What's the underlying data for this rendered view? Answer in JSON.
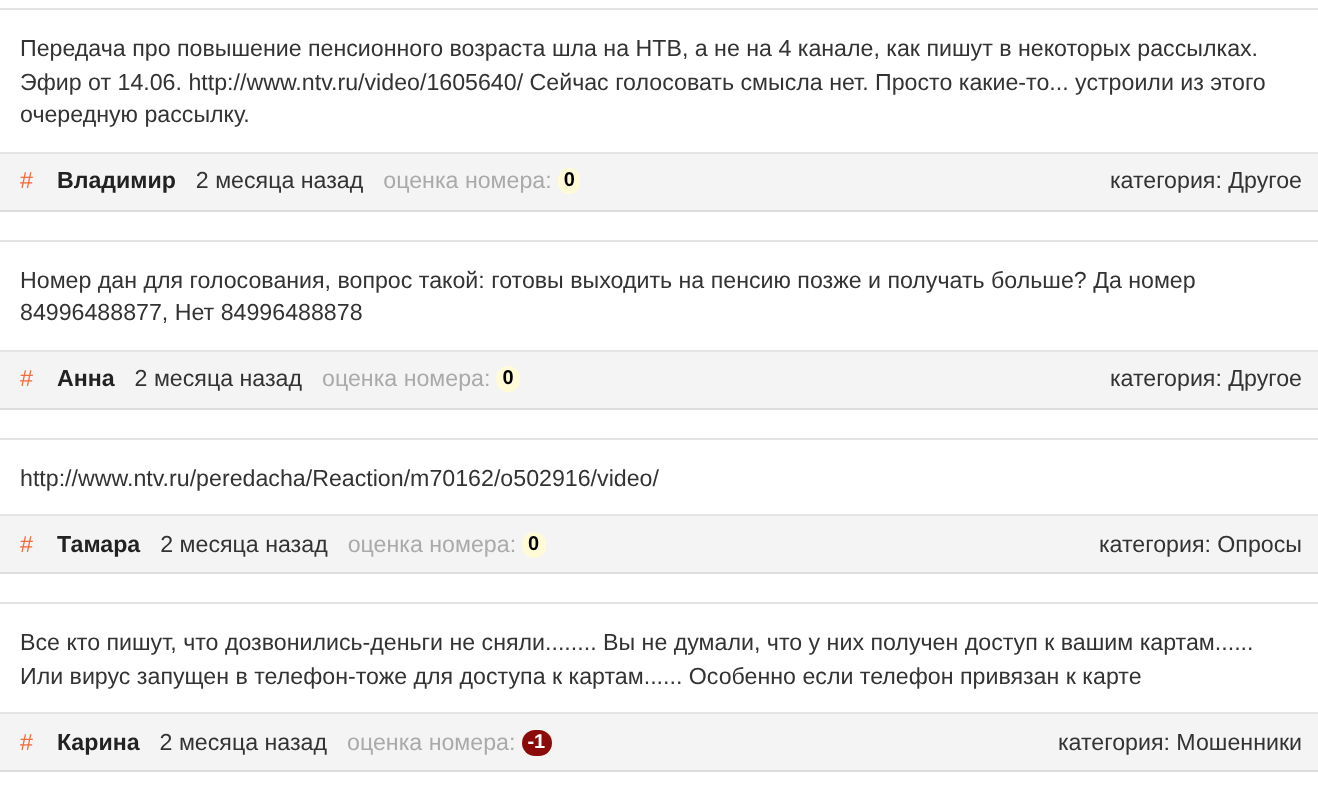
{
  "comments": [
    {
      "text": "Передача про повышение пенсионного возраста шла на НТВ, а не на 4 канале, как пишут в некоторых рассылках. Эфир от 14.06. http://www.ntv.ru/video/1605640/ Сейчас голосовать смысла нет. Просто какие-то... устроили из этого очередную рассылку.",
      "hash": "#",
      "author": "Владимир",
      "time": "2 месяца назад",
      "score_label": "оценка номера:",
      "score": "0",
      "color": "#fffbd6",
      "category": "категория: Другое"
    },
    {
      "text": "Номер дан для голосования, вопрос такой: готовы выходить на пенсию позже и получать больше? Да номер 84996488877, Нет 84996488878",
      "hash": "#",
      "author": "Анна",
      "time": "2 месяца назад",
      "score_label": "оценка номера:",
      "score": "0",
      "color": "#fffbd6",
      "category": "категория: Другое"
    },
    {
      "text": "http://www.ntv.ru/peredacha/Reaction/m70162/o502916/video/",
      "hash": "#",
      "author": "Тамара",
      "time": "2 месяца назад",
      "score_label": "оценка номера:",
      "score": "0",
      "color": "#fffbd6",
      "category": "категория: Опросы"
    },
    {
      "text": "Все кто пишут, что дозвонились-деньги не сняли........ Вы не думали, что у них получен доступ к вашим картам...... Или вирус запущен в телефон-тоже для доступа к картам...... Особенно если телефон привязан к карте",
      "hash": "#",
      "author": "Карина",
      "time": "2 месяца назад",
      "score_label": "оценка номера:",
      "score": "-1",
      "color": "#8b0a0a",
      "category": "категория: Мошенники"
    }
  ]
}
